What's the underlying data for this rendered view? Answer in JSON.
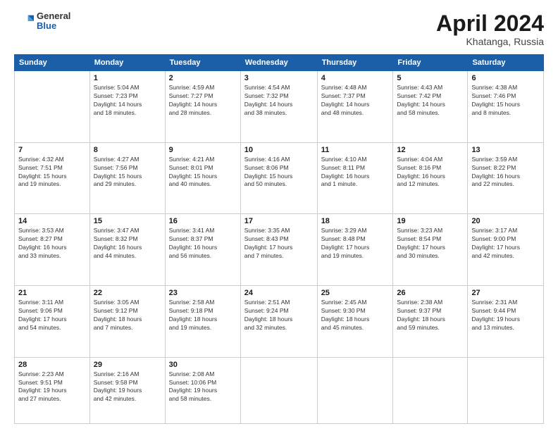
{
  "logo": {
    "general": "General",
    "blue": "Blue"
  },
  "title": {
    "month_year": "April 2024",
    "location": "Khatanga, Russia"
  },
  "days_of_week": [
    "Sunday",
    "Monday",
    "Tuesday",
    "Wednesday",
    "Thursday",
    "Friday",
    "Saturday"
  ],
  "weeks": [
    [
      {
        "day": "",
        "info": ""
      },
      {
        "day": "1",
        "info": "Sunrise: 5:04 AM\nSunset: 7:23 PM\nDaylight: 14 hours\nand 18 minutes."
      },
      {
        "day": "2",
        "info": "Sunrise: 4:59 AM\nSunset: 7:27 PM\nDaylight: 14 hours\nand 28 minutes."
      },
      {
        "day": "3",
        "info": "Sunrise: 4:54 AM\nSunset: 7:32 PM\nDaylight: 14 hours\nand 38 minutes."
      },
      {
        "day": "4",
        "info": "Sunrise: 4:48 AM\nSunset: 7:37 PM\nDaylight: 14 hours\nand 48 minutes."
      },
      {
        "day": "5",
        "info": "Sunrise: 4:43 AM\nSunset: 7:42 PM\nDaylight: 14 hours\nand 58 minutes."
      },
      {
        "day": "6",
        "info": "Sunrise: 4:38 AM\nSunset: 7:46 PM\nDaylight: 15 hours\nand 8 minutes."
      }
    ],
    [
      {
        "day": "7",
        "info": "Sunrise: 4:32 AM\nSunset: 7:51 PM\nDaylight: 15 hours\nand 19 minutes."
      },
      {
        "day": "8",
        "info": "Sunrise: 4:27 AM\nSunset: 7:56 PM\nDaylight: 15 hours\nand 29 minutes."
      },
      {
        "day": "9",
        "info": "Sunrise: 4:21 AM\nSunset: 8:01 PM\nDaylight: 15 hours\nand 40 minutes."
      },
      {
        "day": "10",
        "info": "Sunrise: 4:16 AM\nSunset: 8:06 PM\nDaylight: 15 hours\nand 50 minutes."
      },
      {
        "day": "11",
        "info": "Sunrise: 4:10 AM\nSunset: 8:11 PM\nDaylight: 16 hours\nand 1 minute."
      },
      {
        "day": "12",
        "info": "Sunrise: 4:04 AM\nSunset: 8:16 PM\nDaylight: 16 hours\nand 12 minutes."
      },
      {
        "day": "13",
        "info": "Sunrise: 3:59 AM\nSunset: 8:22 PM\nDaylight: 16 hours\nand 22 minutes."
      }
    ],
    [
      {
        "day": "14",
        "info": "Sunrise: 3:53 AM\nSunset: 8:27 PM\nDaylight: 16 hours\nand 33 minutes."
      },
      {
        "day": "15",
        "info": "Sunrise: 3:47 AM\nSunset: 8:32 PM\nDaylight: 16 hours\nand 44 minutes."
      },
      {
        "day": "16",
        "info": "Sunrise: 3:41 AM\nSunset: 8:37 PM\nDaylight: 16 hours\nand 56 minutes."
      },
      {
        "day": "17",
        "info": "Sunrise: 3:35 AM\nSunset: 8:43 PM\nDaylight: 17 hours\nand 7 minutes."
      },
      {
        "day": "18",
        "info": "Sunrise: 3:29 AM\nSunset: 8:48 PM\nDaylight: 17 hours\nand 19 minutes."
      },
      {
        "day": "19",
        "info": "Sunrise: 3:23 AM\nSunset: 8:54 PM\nDaylight: 17 hours\nand 30 minutes."
      },
      {
        "day": "20",
        "info": "Sunrise: 3:17 AM\nSunset: 9:00 PM\nDaylight: 17 hours\nand 42 minutes."
      }
    ],
    [
      {
        "day": "21",
        "info": "Sunrise: 3:11 AM\nSunset: 9:06 PM\nDaylight: 17 hours\nand 54 minutes."
      },
      {
        "day": "22",
        "info": "Sunrise: 3:05 AM\nSunset: 9:12 PM\nDaylight: 18 hours\nand 7 minutes."
      },
      {
        "day": "23",
        "info": "Sunrise: 2:58 AM\nSunset: 9:18 PM\nDaylight: 18 hours\nand 19 minutes."
      },
      {
        "day": "24",
        "info": "Sunrise: 2:51 AM\nSunset: 9:24 PM\nDaylight: 18 hours\nand 32 minutes."
      },
      {
        "day": "25",
        "info": "Sunrise: 2:45 AM\nSunset: 9:30 PM\nDaylight: 18 hours\nand 45 minutes."
      },
      {
        "day": "26",
        "info": "Sunrise: 2:38 AM\nSunset: 9:37 PM\nDaylight: 18 hours\nand 59 minutes."
      },
      {
        "day": "27",
        "info": "Sunrise: 2:31 AM\nSunset: 9:44 PM\nDaylight: 19 hours\nand 13 minutes."
      }
    ],
    [
      {
        "day": "28",
        "info": "Sunrise: 2:23 AM\nSunset: 9:51 PM\nDaylight: 19 hours\nand 27 minutes."
      },
      {
        "day": "29",
        "info": "Sunrise: 2:16 AM\nSunset: 9:58 PM\nDaylight: 19 hours\nand 42 minutes."
      },
      {
        "day": "30",
        "info": "Sunrise: 2:08 AM\nSunset: 10:06 PM\nDaylight: 19 hours\nand 58 minutes."
      },
      {
        "day": "",
        "info": ""
      },
      {
        "day": "",
        "info": ""
      },
      {
        "day": "",
        "info": ""
      },
      {
        "day": "",
        "info": ""
      }
    ]
  ]
}
